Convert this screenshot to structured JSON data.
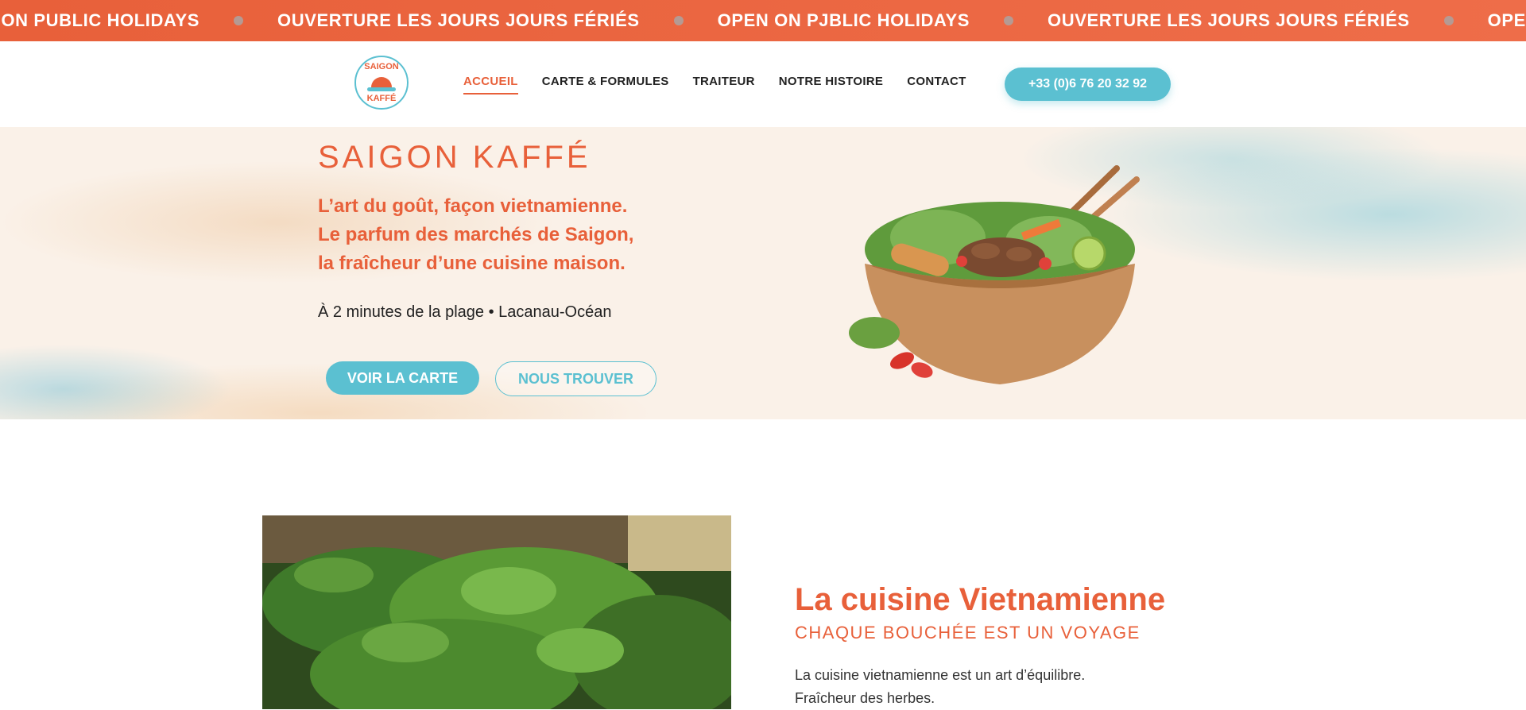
{
  "marquee": {
    "items": [
      "OPEN ON PUBLIC HOLIDAYS",
      "OUVERTURE LES JOURS JOURS FÉRIÉS",
      "OPEN ON PJBLIC HOLIDAYS",
      "OUVERTURE LES JOURS JOURS FÉRIÉS",
      "OPEN ON PUBLIC HOLIDAYS"
    ]
  },
  "header": {
    "logo": {
      "line1": "SAIGON",
      "line2": "KAFFÉ"
    },
    "nav": [
      {
        "label": "ACCUEIL",
        "active": true
      },
      {
        "label": "CARTE & FORMULES",
        "active": false
      },
      {
        "label": "TRAITEUR",
        "active": false
      },
      {
        "label": "NOTRE HISTOIRE",
        "active": false
      },
      {
        "label": "CONTACT",
        "active": false
      }
    ],
    "phone": "+33 (0)6 76 20 32 92"
  },
  "hero": {
    "title": "SAIGON KAFFÉ",
    "tagline": [
      "L’art du goût, façon vietnamienne.",
      "Le parfum des marchés de Saigon,",
      "la fraîcheur d’une cuisine maison."
    ],
    "location": "À 2 minutes de la plage • Lacanau-Océan",
    "buttons": {
      "menu": "VOIR LA CARTE",
      "find": "NOUS TROUVER"
    }
  },
  "intro": {
    "title": "La cuisine Vietnamienne",
    "subtitle": "CHAQUE BOUCHÉE EST UN VOYAGE",
    "text": [
      "La cuisine vietnamienne est un art d’équilibre.",
      "Fraîcheur des herbes."
    ]
  },
  "colors": {
    "accent": "#e8603a",
    "teal": "#5bc0d1",
    "hero_bg": "#faf1e8"
  }
}
